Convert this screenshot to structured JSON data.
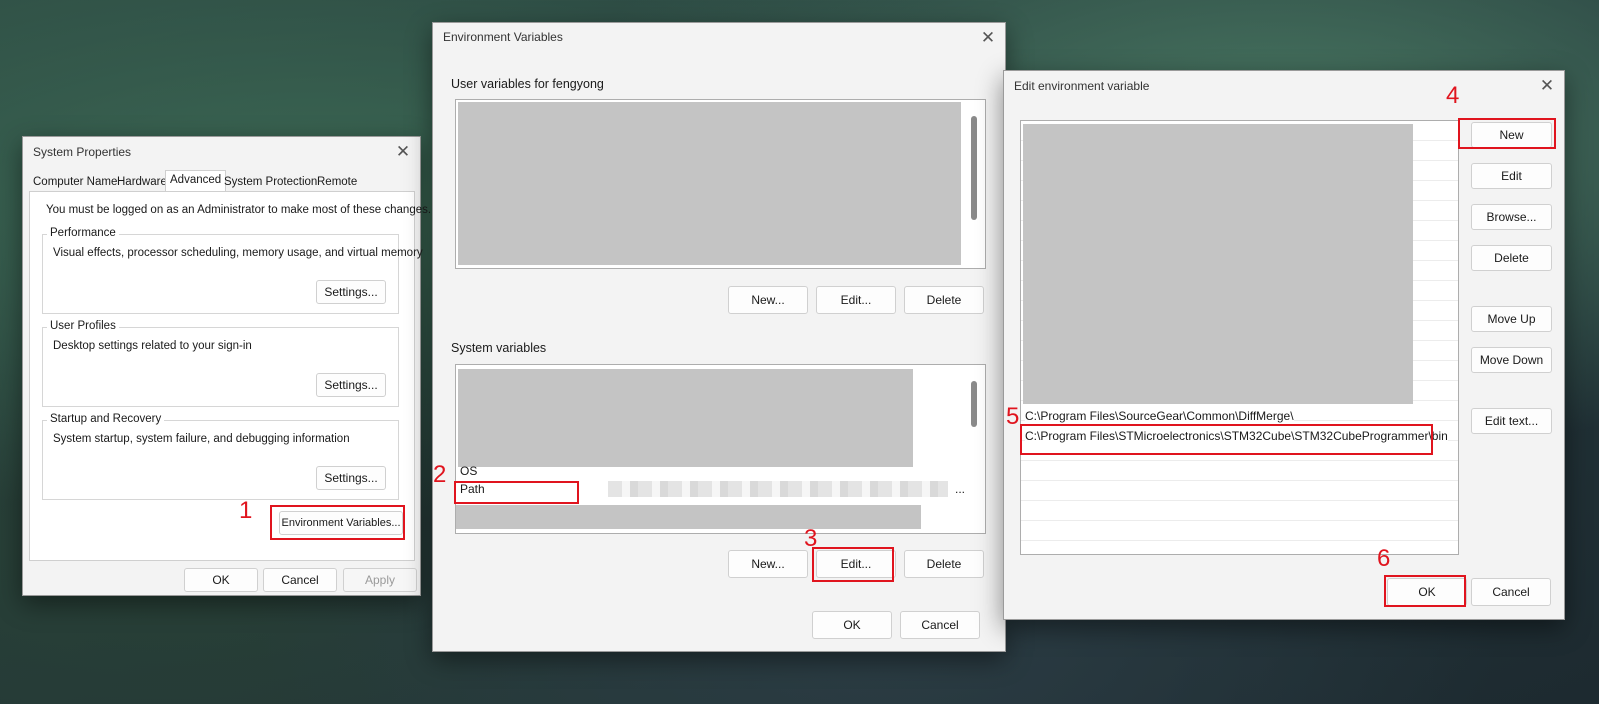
{
  "system_properties": {
    "title": "System Properties",
    "tabs": [
      "Computer Name",
      "Hardware",
      "Advanced",
      "System Protection",
      "Remote"
    ],
    "admin_note": "You must be logged on as an Administrator to make most of these changes.",
    "performance": {
      "title": "Performance",
      "desc": "Visual effects, processor scheduling, memory usage, and virtual memory",
      "button": "Settings..."
    },
    "user_profiles": {
      "title": "User Profiles",
      "desc": "Desktop settings related to your sign-in",
      "button": "Settings..."
    },
    "startup": {
      "title": "Startup and Recovery",
      "desc": "System startup, system failure, and debugging information",
      "button": "Settings..."
    },
    "env_button": "Environment Variables...",
    "ok": "OK",
    "cancel": "Cancel",
    "apply": "Apply"
  },
  "env_vars": {
    "title": "Environment Variables",
    "user_group": "User variables for fengyong",
    "system_group": "System variables",
    "system_rows": [
      "OS",
      "Path"
    ],
    "path_value_ellipsis": "...",
    "new": "New...",
    "edit": "Edit...",
    "delete": "Delete",
    "ok": "OK",
    "cancel": "Cancel"
  },
  "edit_env": {
    "title": "Edit environment variable",
    "entries": [
      "C:\\Program Files\\SourceGear\\Common\\DiffMerge\\",
      "C:\\Program Files\\STMicroelectronics\\STM32Cube\\STM32CubeProgrammer\\bin"
    ],
    "buttons": {
      "new": "New",
      "edit": "Edit",
      "browse": "Browse...",
      "delete": "Delete",
      "move_up": "Move Up",
      "move_down": "Move Down",
      "edit_text": "Edit text..."
    },
    "ok": "OK",
    "cancel": "Cancel"
  },
  "steps": [
    "1",
    "2",
    "3",
    "4",
    "5",
    "6"
  ],
  "colors": {
    "annotation": "#e0141e",
    "redacted": "#c4c4c4"
  }
}
